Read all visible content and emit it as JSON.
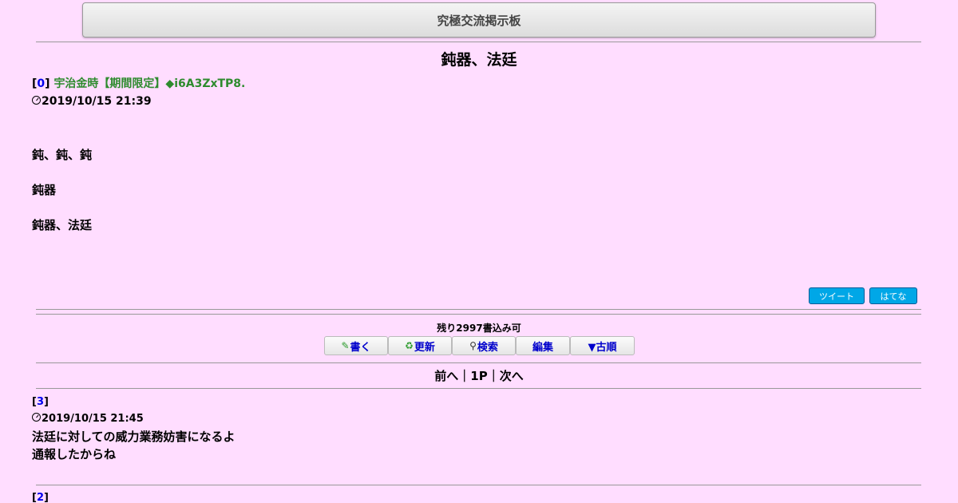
{
  "header": {
    "site_title": "究極交流掲示板"
  },
  "thread": {
    "title": "鈍器、法廷",
    "post0": {
      "number": "0",
      "author": "宇治金時【期間限定】◆i6A3ZxTP8.",
      "date": "2019/10/15 21:39",
      "lines": [
        "鈍、鈍、鈍",
        "鈍器",
        "鈍器、法廷"
      ]
    }
  },
  "share": {
    "tweet_label": "ツイート",
    "hatena_label": "はてな"
  },
  "controls": {
    "remaining_text": "残り2997書込み可",
    "write_label": "書く",
    "refresh_label": "更新",
    "search_label": "検索",
    "edit_label": "編集",
    "order_label": "▼古順"
  },
  "pager": {
    "prev_label": "前へ",
    "page_label": "1P",
    "next_label": "次へ",
    "separator": "｜"
  },
  "replies": [
    {
      "number": "3",
      "date": "2019/10/15 21:45",
      "lines": [
        "法廷に対しての威力業務妨害になるよ",
        "通報したからね"
      ]
    },
    {
      "number": "2"
    }
  ],
  "icons": {
    "write": "pencil-icon",
    "refresh": "refresh-icon",
    "search": "magnifier-icon",
    "clock": "clock-icon"
  },
  "colors": {
    "background": "#ffddff",
    "author_green": "#2e8b2e",
    "link_blue": "#0000ee",
    "share_blue": "#00a7e7"
  }
}
